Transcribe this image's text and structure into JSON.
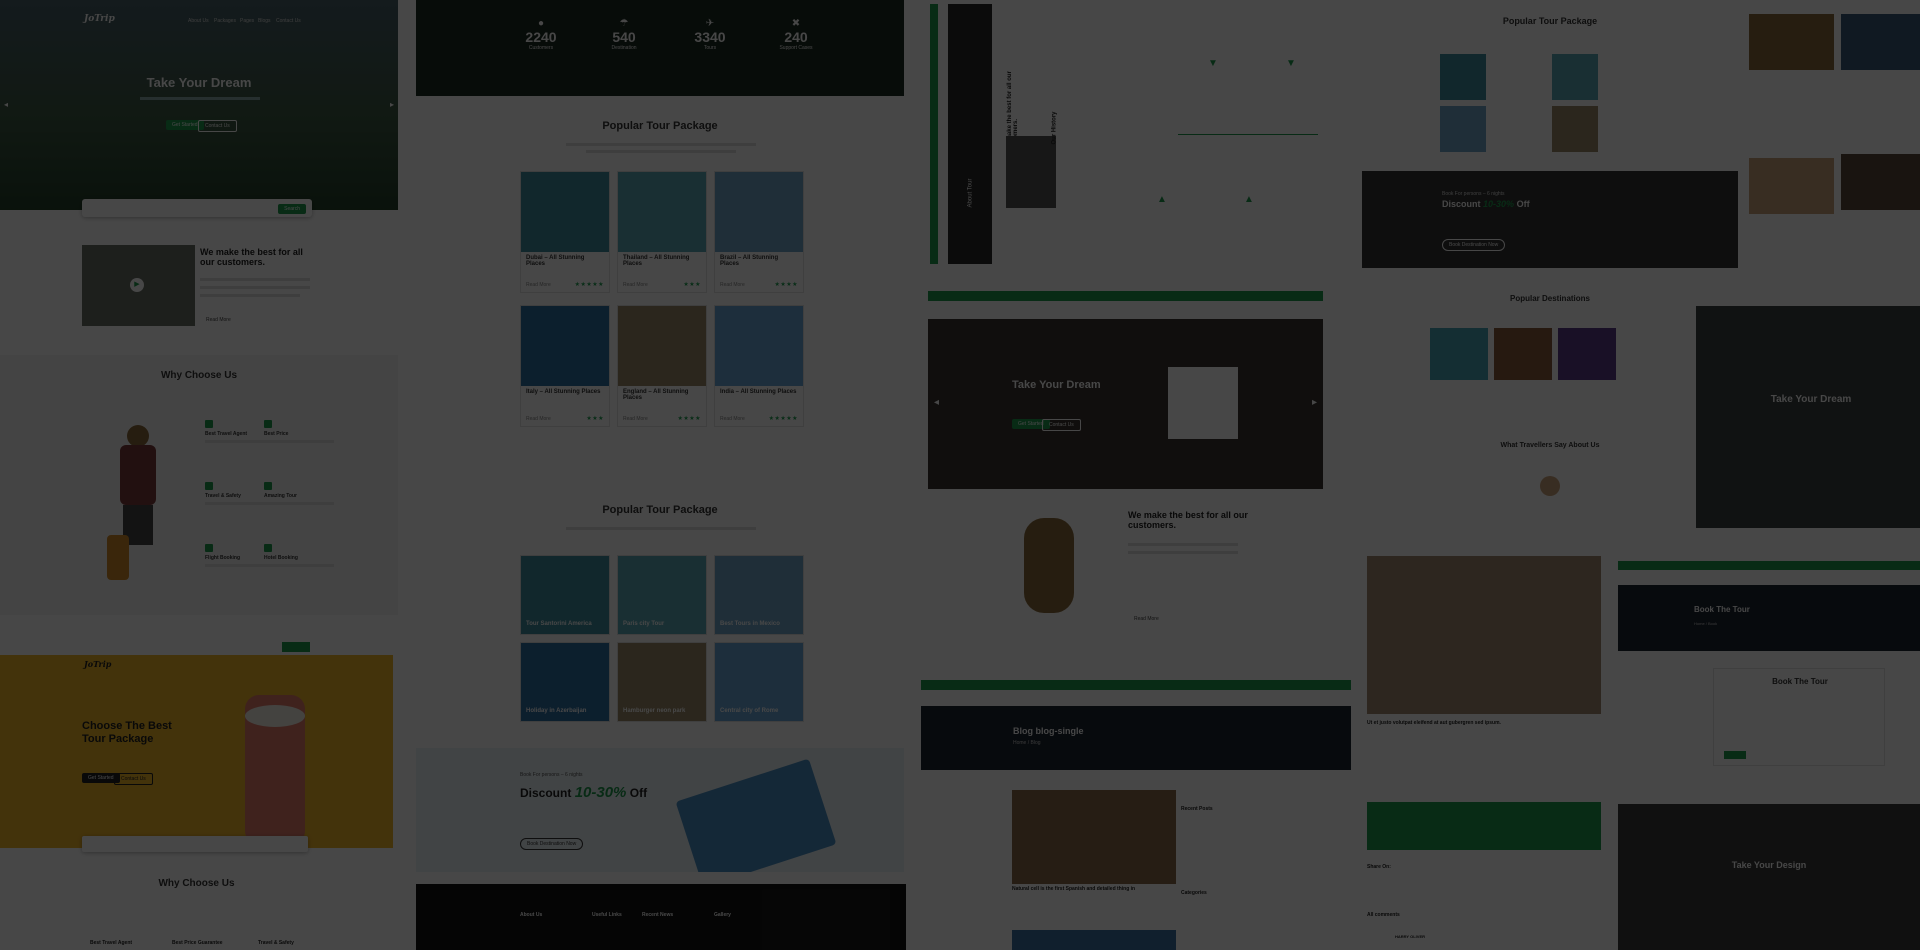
{
  "colors": {
    "accent": "#1d9a4e",
    "dark": "#151515",
    "yellow": "#f1b629"
  },
  "hero1": {
    "logo": "JoTrip",
    "title": "Take Your Dream",
    "nav": [
      "About Us",
      "Packages",
      "Pages",
      "Blogs",
      "Contact Us"
    ],
    "btn1": "Get Started",
    "btn2": "Contact Us",
    "search": "Search"
  },
  "about": {
    "title": "We make the best for all our customers.",
    "more": "Read More"
  },
  "why": {
    "title": "Why Choose Us",
    "items": [
      "Best Travel Agent",
      "Best Price",
      "Travel & Safety",
      "Amazing Tour",
      "Flight Booking",
      "Hotel Booking"
    ]
  },
  "hero2": {
    "title": "Choose The Best Tour Package",
    "btn1": "Get Started",
    "btn2": "Contact Us"
  },
  "why2": {
    "title": "Why Choose Us",
    "items": [
      "Best Travel Agent",
      "Best Price Guarantee",
      "Travel & Safety"
    ]
  },
  "stats": [
    {
      "num": "2240",
      "label": "Customers",
      "icon": "user-icon"
    },
    {
      "num": "540",
      "label": "Destination",
      "icon": "umbrella-icon"
    },
    {
      "num": "3340",
      "label": "Tours",
      "icon": "plane-icon"
    },
    {
      "num": "240",
      "label": "Support Cases",
      "icon": "support-icon"
    }
  ],
  "pkg1": {
    "title": "Popular Tour Package",
    "cards": [
      {
        "title": "Dubai – All Stunning Places",
        "stars": "★★★★★",
        "more": "Read More",
        "color": "#3d8c9e"
      },
      {
        "title": "Thailand – All Stunning Places",
        "stars": "★★★",
        "more": "Read More",
        "color": "#5aa9b8"
      },
      {
        "title": "Brazil – All Stunning Places",
        "stars": "★★★★",
        "more": "Read More",
        "color": "#6fa6c9"
      },
      {
        "title": "Italy – All Stunning Places",
        "stars": "★★★",
        "more": "Read More",
        "color": "#2e6fa3"
      },
      {
        "title": "England – All Stunning Places",
        "stars": "★★★★",
        "more": "Read More",
        "color": "#9a8a6a"
      },
      {
        "title": "India – All Stunning Places",
        "stars": "★★★★★",
        "more": "Read More",
        "color": "#6aa5d6"
      }
    ]
  },
  "pkg2": {
    "title": "Popular Tour Package",
    "cards": [
      {
        "title": "Tour Santorini America",
        "color": "#3d8c9e"
      },
      {
        "title": "Paris city Tour",
        "color": "#5aa9b8"
      },
      {
        "title": "Best Tours in Mexico",
        "color": "#6fa6c9"
      },
      {
        "title": "Holiday in Azerbaijan",
        "color": "#2e6fa3"
      },
      {
        "title": "Hamburger neon park",
        "color": "#9a8a6a"
      },
      {
        "title": "Central city of Rome",
        "color": "#6aa5d6"
      }
    ]
  },
  "discount": {
    "pre": "Book For persons – 6 nights",
    "label": "Discount",
    "pct": "10-30%",
    "off": "Off",
    "btn": "Book Destination Now"
  },
  "footer": {
    "cols": [
      "About Us",
      "Useful Links",
      "Recent News",
      "Gallery"
    ]
  },
  "history": {
    "title": "Our History",
    "vtitle": "We make the best for all our customers.",
    "side": "About Tour"
  },
  "hero3": {
    "title": "Take Your Dream",
    "btn1": "Get Started",
    "btn2": "Contact Us"
  },
  "about2": {
    "title": "We make the best for all our customers.",
    "more": "Read More"
  },
  "blog": {
    "title": "Blog blog-single",
    "crumb": "Home / Blog",
    "post": "Natural cell is the first Spanish and detailed thing in",
    "side1": "Recent Posts",
    "side2": "Categories"
  },
  "pkg3": {
    "title": "Popular Tour Package"
  },
  "discount2": {
    "pre": "Book For persons – 6 nights",
    "label": "Discount",
    "pct": "10-30%",
    "off": "Off",
    "btn": "Book Destination Now"
  },
  "dest": {
    "title": "Popular Destinations"
  },
  "testi": {
    "title": "What Travellers Say About Us"
  },
  "blog2": {
    "title": "Ut et justo volutpat eleifend at aut gubergren sed ipsum.",
    "share": "Share On:",
    "comments": "All comments",
    "author": "HARRY OLIVER"
  },
  "hero4": {
    "title": "Take Your Dream"
  },
  "book": {
    "title": "Book The Tour",
    "crumb": "Home / Book",
    "form": "Book The Tour"
  },
  "hero5": {
    "title": "Take Your Design"
  }
}
